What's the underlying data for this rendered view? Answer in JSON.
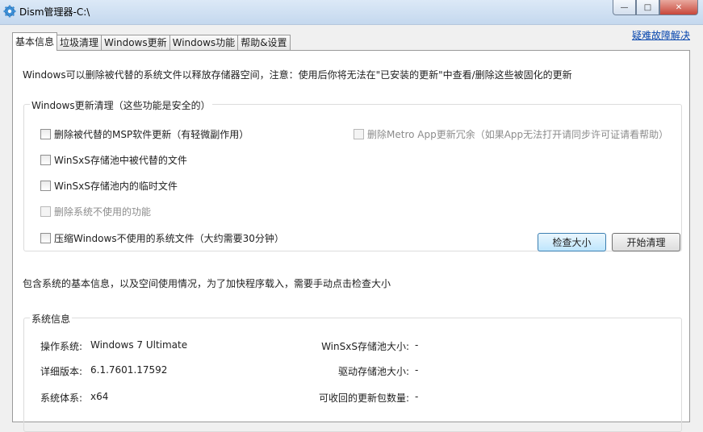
{
  "window": {
    "title": "Dism管理器-C:\\",
    "min_glyph": "—",
    "max_glyph": "□",
    "close_glyph": "✕"
  },
  "tabs": [
    "基本信息",
    "垃圾清理",
    "Windows更新",
    "Windows功能",
    "帮助&设置"
  ],
  "help_link": "疑难故障解决",
  "update": {
    "description": "Windows可以删除被代替的系统文件以释放存储器空间，注意：使用后你将无法在\"已安装的更新\"中查看/删除这些被固化的更新",
    "group_title": "Windows更新清理（这些功能是安全的）",
    "options": {
      "msp": "删除被代替的MSP软件更新（有轻微副作用）",
      "winsxs_superseded": "WinSxS存储池中被代替的文件",
      "winsxs_temp": "WinSxS存储池内的临时文件",
      "remove_unused": "删除系统不使用的功能",
      "compress": "压缩Windows不使用的系统文件（大约需要30分钟）",
      "metro": "删除Metro App更新冗余（如果App无法打开请同步许可证请看帮助）"
    },
    "check_size_button": "检查大小",
    "start_clean_button": "开始清理"
  },
  "sysinfo": {
    "description": "包含系统的基本信息，以及空间使用情况，为了加快程序载入，需要手动点击检查大小",
    "group_title": "系统信息",
    "os_label": "操作系统:",
    "os_value": "Windows 7 Ultimate",
    "version_label": "详细版本:",
    "version_value": "6.1.7601.17592",
    "arch_label": "系统体系:",
    "arch_value": "x64",
    "winsxs_label": "WinSxS存储池大小:",
    "winsxs_value": "-",
    "driver_label": "驱动存储池大小:",
    "driver_value": "-",
    "recoverable_label": "可收回的更新包数量:",
    "recoverable_value": "-"
  }
}
